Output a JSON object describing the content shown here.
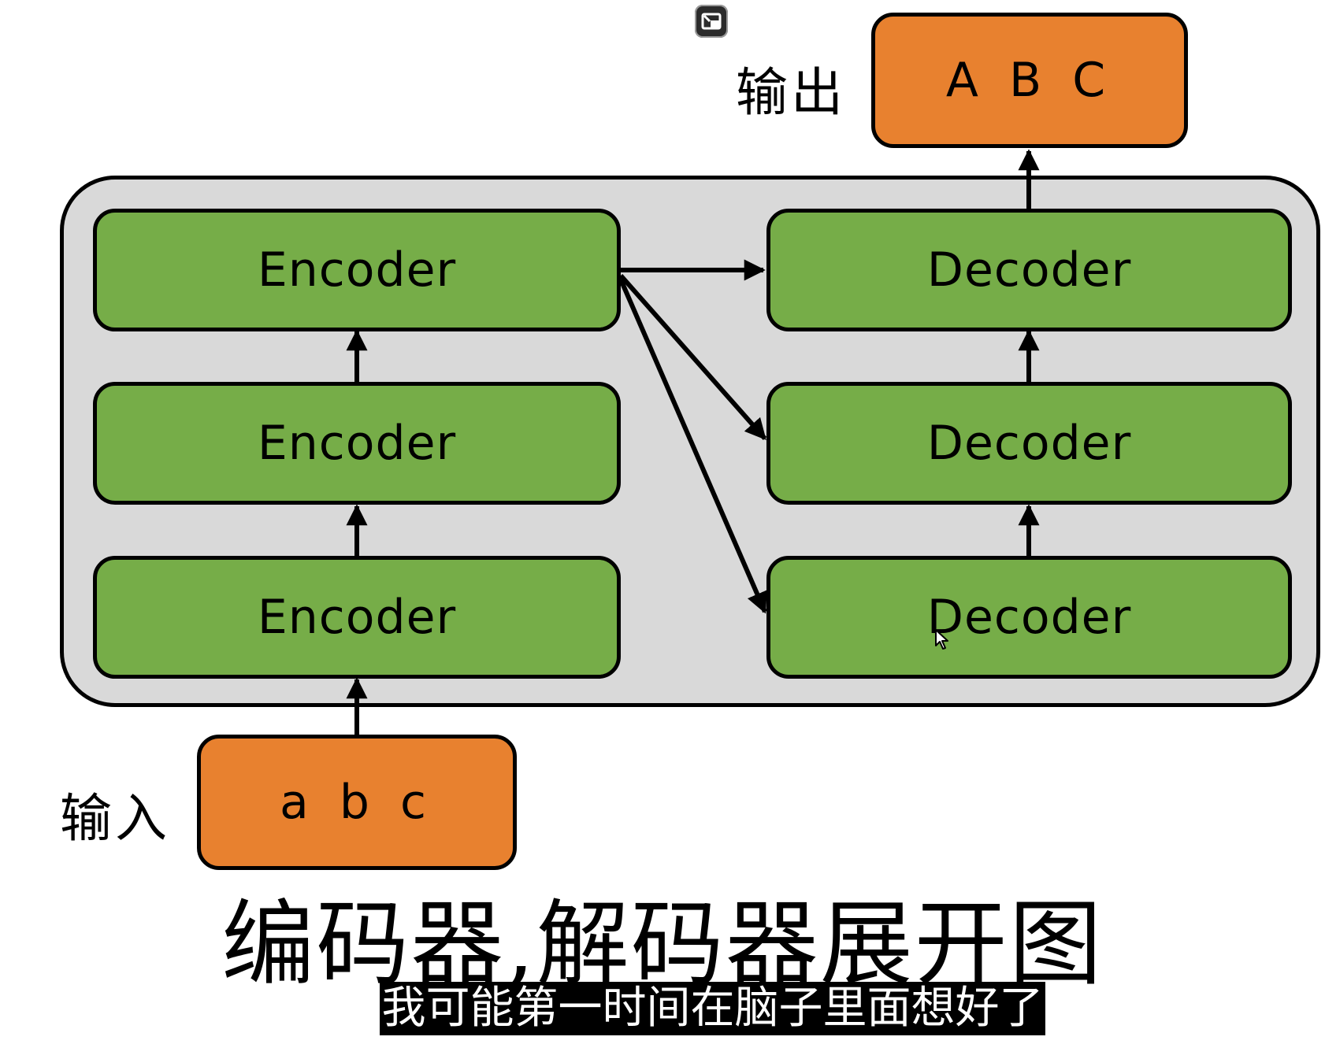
{
  "diagram": {
    "output_label": "输出",
    "output_box": "A B C",
    "input_label": "输入",
    "input_box": "a b c",
    "encoders": [
      "Encoder",
      "Encoder",
      "Encoder"
    ],
    "decoders": [
      "Decoder",
      "Decoder",
      "Decoder"
    ],
    "caption": "编码器,解码器展开图"
  },
  "subtitle": "我可能第一时间在脑子里面想好了",
  "icons": {
    "top_control": "exit-fullscreen-icon",
    "cursor": "mouse-cursor-icon"
  },
  "colors": {
    "block_green": "#76ad48",
    "block_orange": "#e8812f",
    "container_gray": "#d9d9d9",
    "stroke": "#000000",
    "subtitle_bg": "#000000",
    "subtitle_text": "#ffffff"
  }
}
